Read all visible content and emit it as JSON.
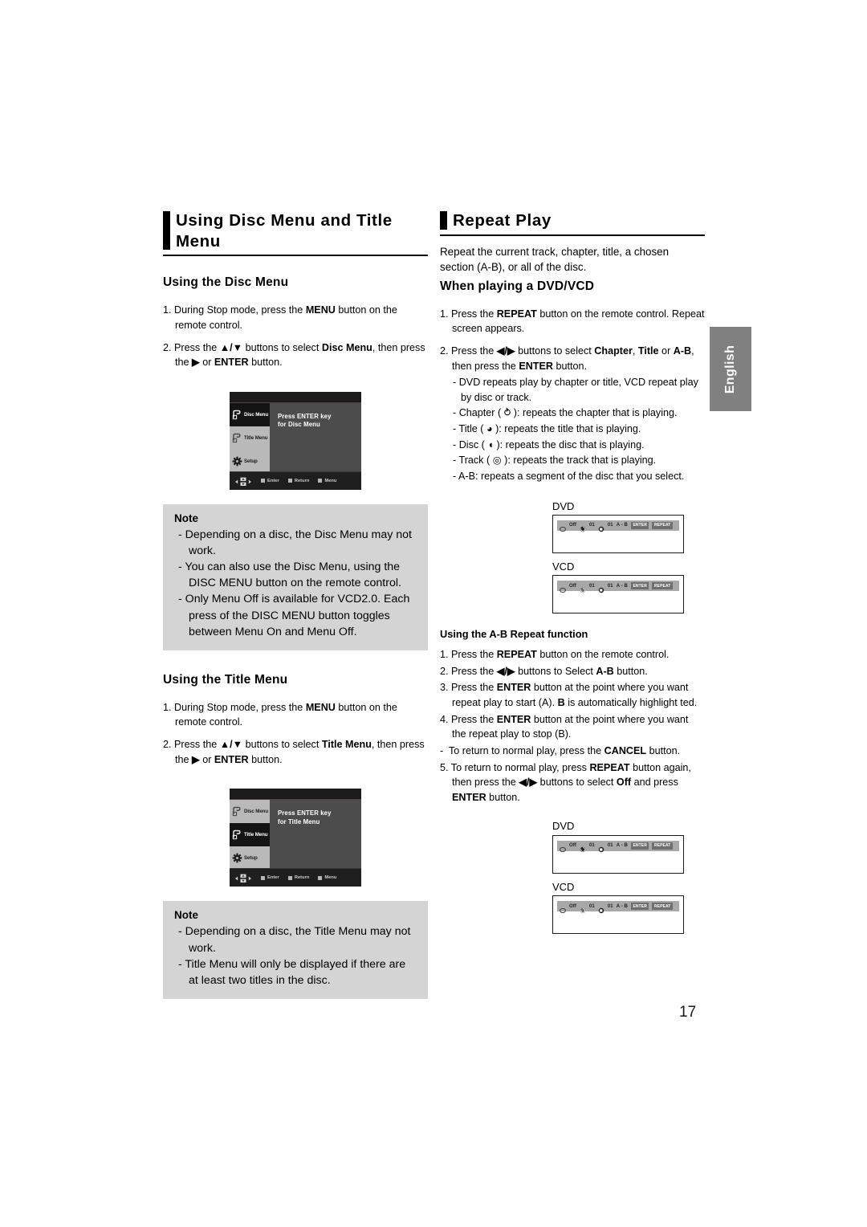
{
  "page": {
    "number": "17",
    "side_tab": "English"
  },
  "left": {
    "heading": "Using Disc Menu and Title Menu",
    "disc_menu": {
      "sub_heading": "Using the Disc Menu",
      "steps": [
        "1. During Stop mode, press the MENU button on the remote control.",
        "2. Press the ▲/▼ buttons to select Disc Menu, then press the ▶ or ENTER button."
      ]
    },
    "disc_tv": {
      "items": [
        {
          "label": "Disc Menu",
          "icon": "disc-menu-icon",
          "state": "selected"
        },
        {
          "label": "Title Menu",
          "icon": "title-menu-icon",
          "state": "grey"
        },
        {
          "label": "Setup",
          "icon": "gear-icon",
          "state": "grey"
        }
      ],
      "message_line1": "Press ENTER key",
      "message_line2": "for Disc Menu",
      "bottom": [
        "Enter",
        "Return",
        "Menu"
      ]
    },
    "note1": {
      "title": "Note",
      "items": [
        "-  Depending on a disc, the Disc Menu may not work.",
        "-  You can also use the Disc Menu, using the DISC MENU button on the remote control.",
        "-  Only Menu Off is available for VCD2.0. Each press of the DISC MENU button toggles between Menu On and Menu Off."
      ]
    },
    "title_menu": {
      "sub_heading": "Using the Title Menu",
      "steps": [
        "1. During Stop mode, press the MENU button on the remote control.",
        "2. Press the ▲/▼ buttons to select Title Menu, then press the ▶ or ENTER button."
      ]
    },
    "title_tv": {
      "items": [
        {
          "label": "Disc Menu",
          "icon": "disc-menu-icon",
          "state": "grey"
        },
        {
          "label": "Title Menu",
          "icon": "title-menu-icon",
          "state": "selected"
        },
        {
          "label": "Setup",
          "icon": "gear-icon",
          "state": "grey"
        }
      ],
      "message_line1": "Press ENTER key",
      "message_line2": "for Title Menu",
      "bottom": [
        "Enter",
        "Return",
        "Menu"
      ]
    },
    "note2": {
      "title": "Note",
      "items": [
        "-  Depending on a disc, the Title Menu may not work.",
        "-  Title Menu will only be displayed if there are at least two titles in the disc."
      ]
    }
  },
  "right": {
    "heading": "Repeat Play",
    "intro": "Repeat the current track, chapter, title, a chosen section (A-B), or all of the disc.",
    "sub_heading": "When playing a DVD/VCD",
    "steps": [
      "1. Press the REPEAT button on the remote control. Repeat screen appears.",
      "2. Press the ◀/▶ buttons to select Chapter, Title or A-B, then press the ENTER button."
    ],
    "bullets": [
      "- DVD repeats play by chapter or title, VCD repeat play by disc or track.",
      "- Chapter (↻): repeats the chapter that is playing.",
      "- Title (◔): repeats the title that is playing.",
      "- Disc (◕): repeats the disc that is playing.",
      "- Track (◎): repeats the track that is playing.",
      "- A-B: repeats a segment of the disc that you select."
    ],
    "osd_top": [
      {
        "label": "DVD",
        "items": [
          "Off",
          "01",
          "01",
          "A - B"
        ],
        "keys": [
          "ENTER",
          "REPEAT"
        ]
      },
      {
        "label": "VCD",
        "items": [
          "Off",
          "01",
          "01",
          "A - B"
        ],
        "keys": [
          "ENTER",
          "REPEAT"
        ]
      }
    ],
    "ab_section": {
      "title": "Using the A-B Repeat function",
      "steps": [
        "1. Press the REPEAT button on the remote control.",
        "2. Press the ◀/▶ buttons to Select A-B button.",
        "3. Press the ENTER button at the point where you want repeat play to start (A). B is automatically highlight ted.",
        "4. Press the ENTER button at the point where you want the repeat play to stop (B).",
        "-  To return to normal play, press the CANCEL button.",
        "5. To return to normal play, press REPEAT button again, then press the ◀/▶ buttons to select Off and press ENTER button."
      ]
    },
    "osd_bottom": [
      {
        "label": "DVD",
        "items": [
          "Off",
          "01",
          "01",
          "A - B"
        ],
        "keys": [
          "ENTER",
          "REPEAT"
        ]
      },
      {
        "label": "VCD",
        "items": [
          "Off",
          "01",
          "01",
          "A - B"
        ],
        "keys": [
          "ENTER",
          "REPEAT"
        ]
      }
    ]
  },
  "colors": {
    "note_bg": "#d4d4d4",
    "tab_bg": "#808080",
    "osd_bar": "#a8a8a8",
    "accent": "#000000"
  }
}
